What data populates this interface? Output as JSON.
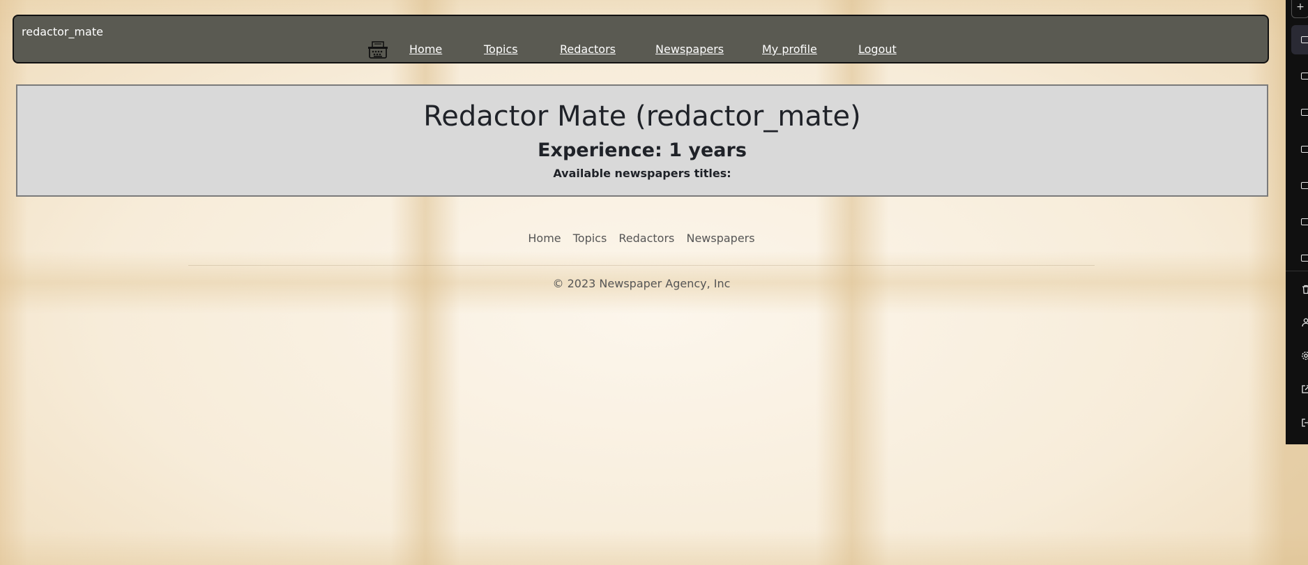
{
  "navbar": {
    "username": "redactor_mate",
    "links": [
      {
        "label": "Home"
      },
      {
        "label": "Topics"
      },
      {
        "label": "Redactors"
      },
      {
        "label": "Newspapers"
      },
      {
        "label": "My profile"
      },
      {
        "label": "Logout"
      }
    ],
    "logo_icon": "typewriter-icon",
    "background_color": "#5a5a52"
  },
  "profile": {
    "title": "Redactor Mate (redactor_mate)",
    "experience": "Experience: 1 years",
    "available_label": "Available newspapers titles:",
    "card_color": "#d9d9d9"
  },
  "footer": {
    "links": [
      {
        "label": "Home"
      },
      {
        "label": "Topics"
      },
      {
        "label": "Redactors"
      },
      {
        "label": "Newspapers"
      }
    ],
    "copyright": "© 2023 Newspaper Agency, Inc"
  },
  "side_panel": {
    "icons": [
      "new-chat-icon",
      "chat-icon",
      "chat-icon",
      "chat-icon",
      "chat-icon",
      "chat-icon",
      "chat-icon",
      "chat-icon",
      "trash-icon",
      "user-icon",
      "gear-icon",
      "external-link-icon",
      "logout-icon"
    ]
  }
}
